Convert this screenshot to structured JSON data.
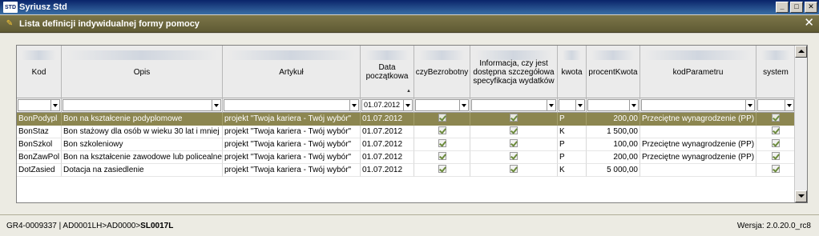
{
  "os_window": {
    "logo": "STD",
    "title": "Syriusz Std",
    "buttons": [
      "_",
      "□",
      "✕"
    ]
  },
  "inner_window": {
    "title": "Lista definicji indywidualnej formy pomocy",
    "close": "✕"
  },
  "grid": {
    "columns": [
      {
        "key": "kod",
        "label": "Kod"
      },
      {
        "key": "opis",
        "label": "Opis"
      },
      {
        "key": "artykul",
        "label": "Artykuł"
      },
      {
        "key": "data",
        "label": "Data początkowa",
        "sorted": true
      },
      {
        "key": "czyBezrobotny",
        "label": "czyBezrobotny"
      },
      {
        "key": "informacja",
        "label": "Informacja, czy jest dostępna szczegółowa specyfikacja wydatków"
      },
      {
        "key": "kwota",
        "label": "kwota"
      },
      {
        "key": "procentKwota",
        "label": "procentKwota"
      },
      {
        "key": "kodParametru",
        "label": "kodParametru"
      },
      {
        "key": "system",
        "label": "system"
      }
    ],
    "filter_values": {
      "data": "01.07.2012"
    },
    "rows": [
      {
        "kod": "BonPodypl",
        "opis": "Bon na kształcenie podyplomowe",
        "artykul": "projekt \"Twoja kariera - Twój wybór\"",
        "data": "01.07.2012",
        "czyBezrobotny": true,
        "informacja": true,
        "kwota": "P",
        "procentKwota": "200,00",
        "kodParametru": "Przeciętne wynagrodzenie (PP)",
        "system": true,
        "selected": true
      },
      {
        "kod": "BonStaz",
        "opis": "Bon stażowy dla osób w wieku 30 lat i mniej",
        "artykul": "projekt \"Twoja kariera - Twój wybór\"",
        "data": "01.07.2012",
        "czyBezrobotny": true,
        "informacja": true,
        "kwota": "K",
        "procentKwota": "1 500,00",
        "kodParametru": "",
        "system": true,
        "selected": false
      },
      {
        "kod": "BonSzkol",
        "opis": "Bon szkoleniowy",
        "artykul": "projekt \"Twoja kariera - Twój wybór\"",
        "data": "01.07.2012",
        "czyBezrobotny": true,
        "informacja": true,
        "kwota": "P",
        "procentKwota": "100,00",
        "kodParametru": "Przeciętne wynagrodzenie (PP)",
        "system": true,
        "selected": false
      },
      {
        "kod": "BonZawPol",
        "opis": "Bon na kształcenie zawodowe lub policealne",
        "artykul": "projekt \"Twoja kariera - Twój wybór\"",
        "data": "01.07.2012",
        "czyBezrobotny": true,
        "informacja": true,
        "kwota": "P",
        "procentKwota": "200,00",
        "kodParametru": "Przeciętne wynagrodzenie (PP)",
        "system": true,
        "selected": false
      },
      {
        "kod": "DotZasied",
        "opis": "Dotacja na zasiedlenie",
        "artykul": "projekt \"Twoja kariera - Twój wybór\"",
        "data": "01.07.2012",
        "czyBezrobotny": true,
        "informacja": true,
        "kwota": "K",
        "procentKwota": "5 000,00",
        "kodParametru": "",
        "system": true,
        "selected": false
      }
    ]
  },
  "status": {
    "path_prefix": "GR4-0009337 | AD0001LH>AD0000>",
    "path_bold": "SL0017L",
    "version": "Wersja: 2.0.20.0_rc8"
  },
  "colors": {
    "selected_row": "#8c8650",
    "inner_header": "#6f6a3e",
    "os_titlebar": "#0a246a"
  }
}
